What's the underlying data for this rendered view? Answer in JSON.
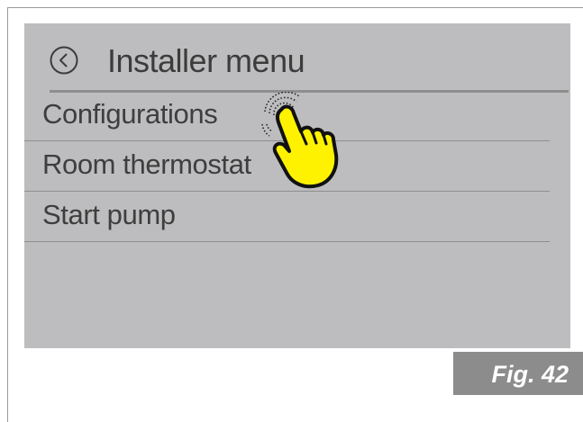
{
  "header": {
    "back_icon": "back-chevron-circle-icon",
    "title": "Installer menu"
  },
  "menu": {
    "items": [
      {
        "label": "Configurations"
      },
      {
        "label": "Room thermostat"
      },
      {
        "label": "Start pump"
      }
    ]
  },
  "overlay": {
    "icon": "tap-hand-pointer-icon",
    "highlight_color": "#FFF200"
  },
  "figure_label": "Fig. 42",
  "colors": {
    "screen_bg": "#BDBDBF",
    "text": "#3C3C3C",
    "fig_tag_bg": "#8C8C8C"
  }
}
